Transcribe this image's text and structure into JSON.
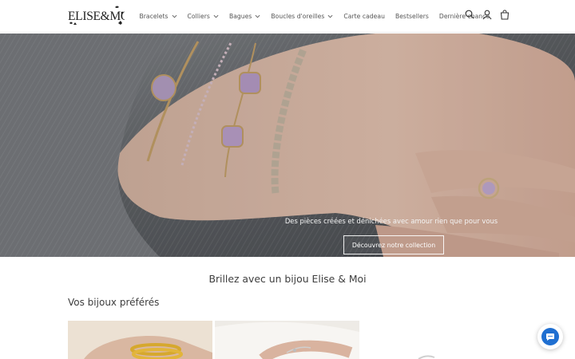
{
  "brand": {
    "logo_text": "ELISE&MOI"
  },
  "nav": {
    "items": [
      {
        "label": "Bracelets",
        "dropdown": true
      },
      {
        "label": "Colliers",
        "dropdown": true
      },
      {
        "label": "Bagues",
        "dropdown": true
      },
      {
        "label": "Boucles d'oreilles",
        "dropdown": true
      },
      {
        "label": "Carte cadeau",
        "dropdown": false
      },
      {
        "label": "Bestsellers",
        "dropdown": false
      },
      {
        "label": "Dernière chance",
        "dropdown": false
      }
    ]
  },
  "header_icons": [
    "search-icon",
    "account-icon",
    "cart-icon"
  ],
  "hero": {
    "text": "Des pièces créées et dénichées avec amour rien que pour vous",
    "cta": "Découvrez notre collection"
  },
  "main": {
    "tagline": "Brillez avec un bijou Elise & Moi",
    "section_title": "Vos bijoux préférés"
  },
  "chat": {
    "icon": "chat-icon",
    "color": "#1f6fd1"
  }
}
